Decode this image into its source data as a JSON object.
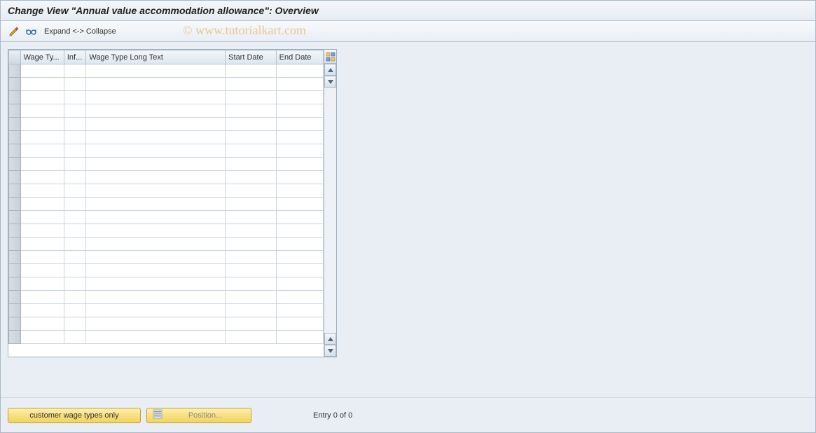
{
  "title": "Change View \"Annual value accommodation allowance\": Overview",
  "toolbar": {
    "expand_collapse": "Expand <-> Collapse"
  },
  "watermark": "© www.tutorialkart.com",
  "table": {
    "headers": {
      "wage_type": "Wage Ty...",
      "inf": "Inf...",
      "long_text": "Wage Type Long Text",
      "start_date": "Start Date",
      "end_date": "End Date"
    },
    "row_count": 21
  },
  "footer": {
    "customer_wage_btn": "customer wage types only",
    "position_btn": "Position...",
    "entry_text": "Entry 0 of 0"
  },
  "icons": {
    "pencil": "pencil-glasses-icon",
    "glasses": "glasses-select-icon",
    "config": "table-config-icon",
    "up": "▴",
    "down": "▾",
    "pos": "position-icon"
  }
}
